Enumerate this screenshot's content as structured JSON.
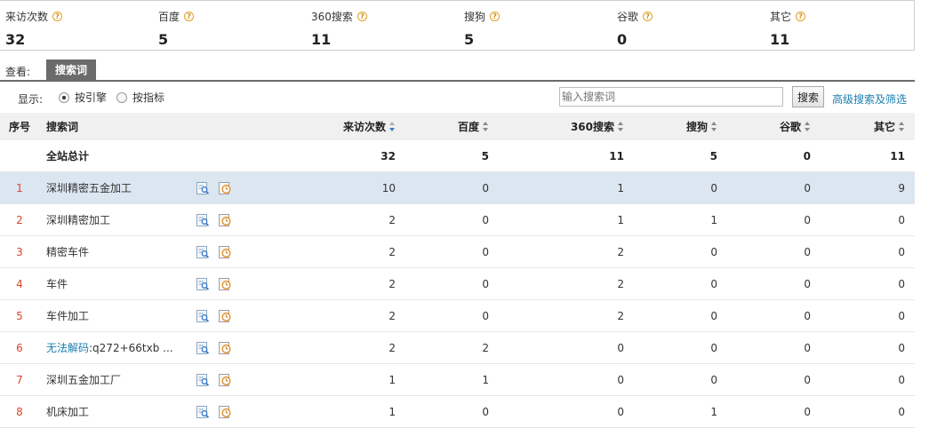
{
  "summary": [
    {
      "label": "来访次数",
      "value": "32"
    },
    {
      "label": "百度",
      "value": "5"
    },
    {
      "label": "360搜索",
      "value": "11"
    },
    {
      "label": "搜狗",
      "value": "5"
    },
    {
      "label": "谷歌",
      "value": "0"
    },
    {
      "label": "其它",
      "value": "11"
    }
  ],
  "view": {
    "label": "查看:",
    "tab": "搜索词"
  },
  "filter": {
    "display_label": "显示:",
    "radio_engine": "按引擎",
    "radio_metric": "按指标",
    "search_placeholder": "输入搜索词",
    "search_button": "搜索",
    "advanced_link": "高级搜索及筛选"
  },
  "table": {
    "headers": {
      "idx": "序号",
      "keyword": "搜索词",
      "visits": "来访次数",
      "baidu": "百度",
      "s360": "360搜索",
      "sogou": "搜狗",
      "google": "谷歌",
      "other": "其它"
    },
    "total": {
      "label": "全站总计",
      "visits": "32",
      "baidu": "5",
      "s360": "11",
      "sogou": "5",
      "google": "0",
      "other": "11"
    },
    "rows": [
      {
        "idx": "1",
        "kw": "深圳精密五金加工",
        "kw_prefix": "",
        "visits": "10",
        "baidu": "0",
        "s360": "1",
        "sogou": "0",
        "google": "0",
        "other": "9"
      },
      {
        "idx": "2",
        "kw": "深圳精密加工",
        "kw_prefix": "",
        "visits": "2",
        "baidu": "0",
        "s360": "1",
        "sogou": "1",
        "google": "0",
        "other": "0"
      },
      {
        "idx": "3",
        "kw": "精密车件",
        "kw_prefix": "",
        "visits": "2",
        "baidu": "0",
        "s360": "2",
        "sogou": "0",
        "google": "0",
        "other": "0"
      },
      {
        "idx": "4",
        "kw": "车件",
        "kw_prefix": "",
        "visits": "2",
        "baidu": "0",
        "s360": "2",
        "sogou": "0",
        "google": "0",
        "other": "0"
      },
      {
        "idx": "5",
        "kw": "车件加工",
        "kw_prefix": "",
        "visits": "2",
        "baidu": "0",
        "s360": "2",
        "sogou": "0",
        "google": "0",
        "other": "0"
      },
      {
        "idx": "6",
        "kw": ":q272+66txb ...",
        "kw_prefix": "无法解码",
        "visits": "2",
        "baidu": "2",
        "s360": "0",
        "sogou": "0",
        "google": "0",
        "other": "0"
      },
      {
        "idx": "7",
        "kw": "深圳五金加工厂",
        "kw_prefix": "",
        "visits": "1",
        "baidu": "1",
        "s360": "0",
        "sogou": "0",
        "google": "0",
        "other": "0"
      },
      {
        "idx": "8",
        "kw": "机床加工",
        "kw_prefix": "",
        "visits": "1",
        "baidu": "0",
        "s360": "0",
        "sogou": "1",
        "google": "0",
        "other": "0"
      }
    ]
  },
  "colors": {
    "accent_link": "#1a7fb0",
    "index_red": "#d9452a",
    "tab_bg": "#6b6b6b",
    "highlight_row": "#dce6f1"
  }
}
